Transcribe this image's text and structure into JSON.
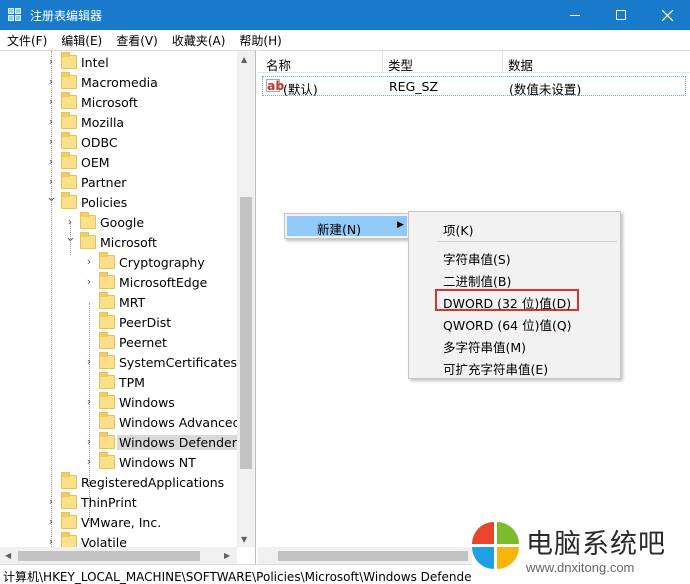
{
  "window": {
    "title": "注册表编辑器"
  },
  "menu": [
    "文件(F)",
    "编辑(E)",
    "查看(V)",
    "收藏夹(A)",
    "帮助(H)"
  ],
  "tree": [
    {
      "label": "Intel",
      "level": 0,
      "expander": "collapsed"
    },
    {
      "label": "Macromedia",
      "level": 0,
      "expander": "collapsed"
    },
    {
      "label": "Microsoft",
      "level": 0,
      "expander": "collapsed"
    },
    {
      "label": "Mozilla",
      "level": 0,
      "expander": "collapsed"
    },
    {
      "label": "ODBC",
      "level": 0,
      "expander": "collapsed"
    },
    {
      "label": "OEM",
      "level": 0,
      "expander": "collapsed"
    },
    {
      "label": "Partner",
      "level": 0,
      "expander": "collapsed"
    },
    {
      "label": "Policies",
      "level": 0,
      "expander": "expanded"
    },
    {
      "label": "Google",
      "level": 1,
      "expander": "collapsed"
    },
    {
      "label": "Microsoft",
      "level": 1,
      "expander": "expanded"
    },
    {
      "label": "Cryptography",
      "level": 2,
      "expander": "collapsed"
    },
    {
      "label": "MicrosoftEdge",
      "level": 2,
      "expander": "collapsed"
    },
    {
      "label": "MRT",
      "level": 2,
      "expander": "none"
    },
    {
      "label": "PeerDist",
      "level": 2,
      "expander": "none"
    },
    {
      "label": "Peernet",
      "level": 2,
      "expander": "none"
    },
    {
      "label": "SystemCertificates",
      "level": 2,
      "expander": "collapsed"
    },
    {
      "label": "TPM",
      "level": 2,
      "expander": "none"
    },
    {
      "label": "Windows",
      "level": 2,
      "expander": "collapsed"
    },
    {
      "label": "Windows Advanced",
      "level": 2,
      "expander": "none"
    },
    {
      "label": "Windows Defender",
      "level": 2,
      "expander": "collapsed",
      "selected": true
    },
    {
      "label": "Windows NT",
      "level": 2,
      "expander": "collapsed"
    },
    {
      "label": "RegisteredApplications",
      "level": 0,
      "expander": "none"
    },
    {
      "label": "ThinPrint",
      "level": 0,
      "expander": "collapsed"
    },
    {
      "label": "VMware, Inc.",
      "level": 0,
      "expander": "collapsed"
    },
    {
      "label": "Volatile",
      "level": 0,
      "expander": "collapsed"
    }
  ],
  "list": {
    "columns": [
      "名称",
      "类型",
      "数据"
    ],
    "rows": [
      {
        "name": "(默认)",
        "type": "REG_SZ",
        "data": "(数值未设置)"
      }
    ]
  },
  "context_menu": {
    "parent_item": "新建(N)",
    "submenu": [
      "项(K)",
      "字符串值(S)",
      "二进制值(B)",
      "DWORD (32 位)值(D)",
      "QWORD (64 位)值(Q)",
      "多字符串值(M)",
      "可扩充字符串值(E)"
    ],
    "highlighted": "DWORD (32 位)值(D)"
  },
  "status": "计算机\\HKEY_LOCAL_MACHINE\\SOFTWARE\\Policies\\Microsoft\\Windows Defender",
  "watermark": {
    "text": "电脑系统吧",
    "url": "www.dnxitong.com"
  },
  "colors": {
    "titlebar": "#1979ca",
    "selection": "#91c9f7",
    "highlight_box": "#d9332b"
  }
}
